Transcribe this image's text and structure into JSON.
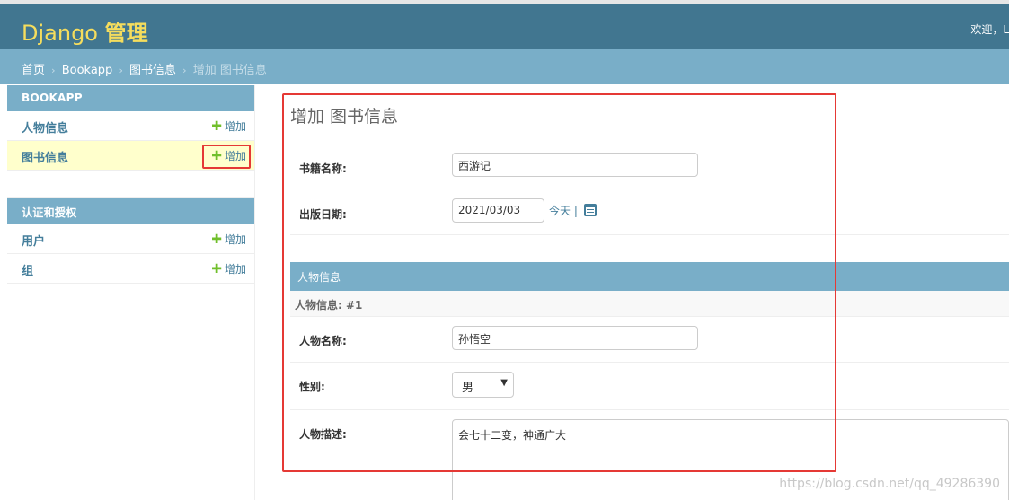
{
  "header": {
    "brand_prefix": "Django",
    "brand_suffix": "管理",
    "welcome": "欢迎，L"
  },
  "breadcrumbs": {
    "home": "首页",
    "app": "Bookapp",
    "model": "图书信息",
    "current": "增加 图书信息",
    "separator": "›"
  },
  "sidebar": {
    "modules": [
      {
        "caption": "BOOKAPP",
        "items": [
          {
            "label": "人物信息",
            "add": "增加"
          },
          {
            "label": "图书信息",
            "add": "增加"
          }
        ]
      },
      {
        "caption": "认证和授权",
        "items": [
          {
            "label": "用户",
            "add": "增加"
          },
          {
            "label": "组",
            "add": "增加"
          }
        ]
      }
    ]
  },
  "form": {
    "title": "增加 图书信息",
    "fields": {
      "book_name": {
        "label": "书籍名称:",
        "value": "西游记"
      },
      "pub_date": {
        "label": "出版日期:",
        "value": "2021/03/03",
        "today": "今天",
        "divider": "|"
      }
    },
    "inline": {
      "caption": "人物信息",
      "subheader": "人物信息: #1",
      "name": {
        "label": "人物名称:",
        "value": "孙悟空"
      },
      "gender": {
        "label": "性别:",
        "value": "男"
      },
      "desc": {
        "label": "人物描述:",
        "value": "会七十二变，神通广大"
      }
    }
  },
  "watermark": "https://blog.csdn.net/qq_49286390",
  "colors": {
    "header_bg": "#417690",
    "breadcrumb_bg": "#79aec8",
    "brand_yellow": "#f5dd5d",
    "link": "#447e9b",
    "add_green": "#70bf2b",
    "annotation_red": "#e53935"
  },
  "icons": {
    "add": "plus-icon",
    "calendar": "calendar-icon",
    "select": "chevron-down-icon"
  }
}
